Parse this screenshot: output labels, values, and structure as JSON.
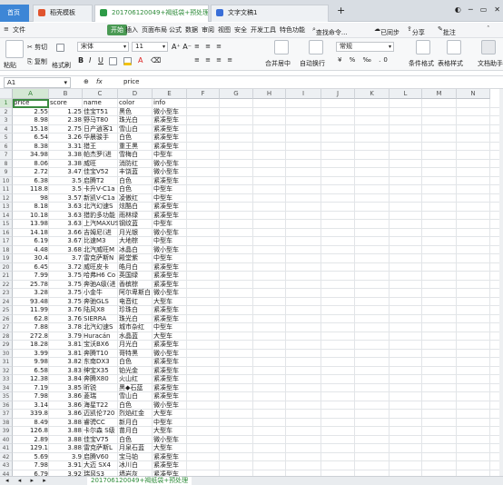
{
  "tabs": {
    "home": "首页",
    "t1": "稻壳模板",
    "t2": "201706120049+褐纸袋+预处理.csv",
    "t3": "文字文稿1",
    "close": "×",
    "plus": "+"
  },
  "menu": {
    "file": "文件",
    "start": "开始",
    "insert": "插入",
    "layout": "页面布局",
    "formula": "公式",
    "data": "数据",
    "review": "审阅",
    "view": "视图",
    "security": "安全",
    "dev": "开发工具",
    "special": "特色功能",
    "search": "查找命令...",
    "cloud": "已同步",
    "share": "分享",
    "comment": "批注"
  },
  "toolbar": {
    "paste": "粘贴",
    "cut": "剪切",
    "copy": "复制",
    "format_painter": "格式刷",
    "font": "宋体",
    "size": "11",
    "merge": "合并居中",
    "wrap": "自动换行",
    "numfmt": "常规",
    "cond": "条件格式",
    "table_style": "表格样式",
    "doc_assist": "文档助手"
  },
  "formula": {
    "cell": "A1",
    "fx": "fx",
    "value": "price"
  },
  "columns": [
    "A",
    "B",
    "C",
    "D",
    "E",
    "F",
    "G",
    "H",
    "I",
    "J",
    "K",
    "L",
    "M",
    "N"
  ],
  "headers": [
    "price",
    "score",
    "name",
    "color",
    "info"
  ],
  "rows": [
    [
      "2.55",
      "1.25",
      "佳宝T51",
      "黑色",
      "微小型车"
    ],
    [
      "8.98",
      "2.38",
      "野马T80",
      "珠光白",
      "紧凑型车"
    ],
    [
      "15.18",
      "2.75",
      "日产逍客1",
      "雪山白",
      "紧凑型车"
    ],
    [
      "6.54",
      "3.26",
      "华晨骏手",
      "白色",
      "紧凑型车"
    ],
    [
      "8.38",
      "3.31",
      "猎王",
      "重王黑",
      "紧凑型车"
    ],
    [
      "34.98",
      "3.38",
      "帕杰罗(进",
      "雪梅白",
      "中型车"
    ],
    [
      "8.06",
      "3.38",
      "威旺",
      "消防红",
      "微小型车"
    ],
    [
      "2.72",
      "3.47",
      "佳宝V52",
      "丰饶蓝",
      "微小型车"
    ],
    [
      "6.38",
      "3.5",
      "启腾T2",
      "白色",
      "紧凑型车"
    ],
    [
      "118.8",
      "3.5",
      "卡升V-C1a",
      "白色",
      "中型车"
    ],
    [
      "98",
      "3.57",
      "新凯V-C1a",
      "凌傲红",
      "中型车"
    ],
    [
      "8.18",
      "3.63",
      "北汽幻速S",
      "炫酷白",
      "紧凑型车"
    ],
    [
      "10.18",
      "3.63",
      "猎豹多功能",
      "雨林绿",
      "紧凑型车"
    ],
    [
      "13.98",
      "3.63",
      "上汽MAXUS",
      "钢纹蓝",
      "中型车"
    ],
    [
      "14.18",
      "3.66",
      "吉姆尼(进",
      "月光银",
      "微小型车"
    ],
    [
      "6.19",
      "3.67",
      "比速M3",
      "大地棕",
      "中型车"
    ],
    [
      "4.48",
      "3.68",
      "北汽威旺M",
      "冰晶白",
      "微小型车"
    ],
    [
      "30.4",
      "3.7",
      "雷克萨斯N",
      "殿堂紫",
      "中型车"
    ],
    [
      "6.45",
      "3.72",
      "威旺皮卡",
      "皓月白",
      "紧凑型车"
    ],
    [
      "7.99",
      "3.75",
      "哈弗H6 Co",
      "英国绿",
      "紧凑型车"
    ],
    [
      "25.78",
      "3.75",
      "奔驰A级(进",
      "香槟棕",
      "紧凑型车"
    ],
    [
      "3.28",
      "3.75",
      "小金牛",
      "阿尔卑斯白",
      "微小型车"
    ],
    [
      "93.48",
      "3.75",
      "奔驰GLS",
      "电音红",
      "大型车"
    ],
    [
      "11.99",
      "3.76",
      "陆风X8",
      "珍珠白",
      "紧凑型车"
    ],
    [
      "62.8",
      "3.76",
      "SIERRA",
      "珠光白",
      "紧凑型车"
    ],
    [
      "7.88",
      "3.78",
      "北汽幻速S",
      "城市杂红",
      "中型车"
    ],
    [
      "272.8",
      "3.79",
      "Huracán",
      "水晶蓝",
      "大型车"
    ],
    [
      "18.28",
      "3.81",
      "宝沃BX6",
      "月光白",
      "紧凑型车"
    ],
    [
      "3.99",
      "3.81",
      "奔腾T10",
      "哥特黑",
      "微小型车"
    ],
    [
      "9.98",
      "3.82",
      "东南DX3",
      "白色",
      "紧凑型车"
    ],
    [
      "6.58",
      "3.83",
      "绅宝X35",
      "铂光金",
      "紧凑型车"
    ],
    [
      "12.38",
      "3.84",
      "奔腾X80",
      "火山红",
      "紧凑型车"
    ],
    [
      "7.19",
      "3.85",
      "昕锐",
      "黑◆石蓝",
      "紧凑型车"
    ],
    [
      "7.98",
      "3.86",
      "菱瑞",
      "雪山白",
      "紧凑型车"
    ],
    [
      "3.14",
      "3.86",
      "海星T22",
      "白色",
      "微小型车"
    ],
    [
      "339.8",
      "3.86",
      "迈凯伦720",
      "烈焰红金",
      "大型车"
    ],
    [
      "8.49",
      "3.88",
      "睿骋CC",
      "新月白",
      "中型车"
    ],
    [
      "126.8",
      "3.88",
      "卡尔森 S级",
      "苗月白",
      "大型车"
    ],
    [
      "2.89",
      "3.88",
      "佳宝V75",
      "白色",
      "微小型车"
    ],
    [
      "129.1",
      "3.88",
      "雷克萨斯L",
      "月泉石蓝",
      "大型车"
    ],
    [
      "5.69",
      "3.9",
      "启腾V60",
      "宝马铂",
      "紧凑型车"
    ],
    [
      "7.98",
      "3.91",
      "大迈 SX4",
      "冰川白",
      "紧凑型车"
    ],
    [
      "6.79",
      "3.92",
      "瑞风S3",
      "墙岩灰",
      "紧凑型车"
    ]
  ],
  "sheet": {
    "name": "201706120049+褐纸袋+预处理"
  }
}
